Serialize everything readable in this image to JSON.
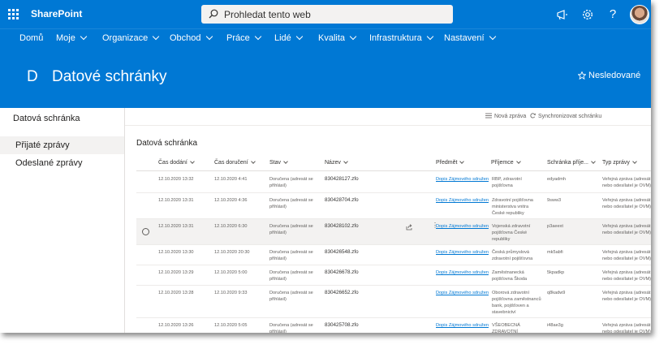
{
  "suite": {
    "brand": "SharePoint",
    "search_placeholder": "Prohledat tento web"
  },
  "nav": {
    "items": [
      {
        "label": "Domů",
        "dropdown": false
      },
      {
        "label": "Moje",
        "dropdown": true
      },
      {
        "label": "Organizace",
        "dropdown": true
      },
      {
        "label": "Obchod",
        "dropdown": true
      },
      {
        "label": "Práce",
        "dropdown": true
      },
      {
        "label": "Lidé",
        "dropdown": true
      },
      {
        "label": "Kvalita",
        "dropdown": true
      },
      {
        "label": "Infrastruktura",
        "dropdown": true
      },
      {
        "label": "Nastavení",
        "dropdown": true
      }
    ]
  },
  "site": {
    "logo_letter": "D",
    "title": "Datové schránky",
    "follow_label": "Nesledované"
  },
  "leftnav": {
    "title": "Datová schránka",
    "items": [
      "Přijaté zprávy",
      "Odeslané zprávy"
    ],
    "selected_index": 0
  },
  "commands": {
    "new": "Nová zpráva",
    "sync": "Synchronizovat schránku"
  },
  "list": {
    "title": "Datová schránka",
    "columns": [
      "Čas dodání",
      "Čas doručení",
      "Stav",
      "Název",
      "Předmět",
      "Příjemce",
      "Schránka příje...",
      "Typ zprávy"
    ],
    "rows": [
      {
        "dodani": "12.10.2020 13:32",
        "doruceni": "12.10.2020 4:41",
        "stav": "Doručena (adresát se přihlásil)",
        "nazev": "830428127.zfo",
        "predmet": "Dopis Zájmového sdružen",
        "prijemce": "RBP, zdravotní pojišťovna",
        "schranka": "edyadmh",
        "typ": "Veřejná zpráva (adresát nebo odesílatel je OVM)"
      },
      {
        "dodani": "12.10.2020 13:31",
        "doruceni": "12.10.2020 4:36",
        "stav": "Doručena (adresát se přihlásil)",
        "nazev": "830428704.zfo",
        "predmet": "Dopis Zájmového sdružen",
        "prijemce": "Zdravotní pojišťovna ministerstva vnitra České republiky",
        "schranka": "9sww3",
        "typ": "Veřejná zpráva (adresát nebo odesílatel je OVM)"
      },
      {
        "dodani": "12.10.2020 13:31",
        "doruceni": "12.10.2020 6:30",
        "stav": "Doručena (adresát se přihlásil)",
        "nazev": "830428102.zfo",
        "predmet": "Dopis Zájmového sdružen",
        "prijemce": "Vojenská zdravotní pojišťovna České republiky",
        "schranka": "p3aeext",
        "typ": "Veřejná zpráva (adresát nebo odesílatel je OVM)"
      },
      {
        "dodani": "12.10.2020 13:30",
        "doruceni": "12.10.2020 20:30",
        "stav": "Doručena (adresát se přihlásil)",
        "nazev": "830426548.zfo",
        "predmet": "Dopis Zájmového sdružen",
        "prijemce": "Česká průmyslová zdravotní pojišťovna",
        "schranka": "mk5abfi",
        "typ": "Veřejná zpráva (adresát nebo odesílatel je OVM)"
      },
      {
        "dodani": "12.10.2020 13:29",
        "doruceni": "12.10.2020 5:00",
        "stav": "Doručena (adresát se přihlásil)",
        "nazev": "830426678.zfo",
        "predmet": "Dopis Zájmového sdružen",
        "prijemce": "Zaměstnanecká pojišťovna Škoda",
        "schranka": "5kpadkp",
        "typ": "Veřejná zpráva (adresát nebo odesílatel je OVM)"
      },
      {
        "dodani": "12.10.2020 13:28",
        "doruceni": "12.10.2020 9:33",
        "stav": "Doručena (adresát se přihlásil)",
        "nazev": "830426652.zfo",
        "predmet": "Dopis Zájmového sdružen",
        "prijemce": "Oborová zdravotní pojišťovna zaměstnanců bank, pojišťoven a stavebnictví",
        "schranka": "q8kadw9",
        "typ": "Veřejná zpráva (adresát nebo odesílatel je OVM)"
      },
      {
        "dodani": "12.10.2020 13:26",
        "doruceni": "12.10.2020 5:05",
        "stav": "Doručena (adresát se přihlásil)",
        "nazev": "830425708.zfo",
        "predmet": "Dopis Zájmového sdružen",
        "prijemce": "VŠEOBECNÁ ZDRAVOTNÍ",
        "schranka": "i48ae3g",
        "typ": "Veřejná zpráva (adresát nebo odesílatel je OVM)"
      }
    ],
    "highlighted_row": 2
  },
  "colors": {
    "brand_blue": "#0078d4",
    "link": "#0078d4",
    "row_highlight": "#f3f2f1"
  }
}
